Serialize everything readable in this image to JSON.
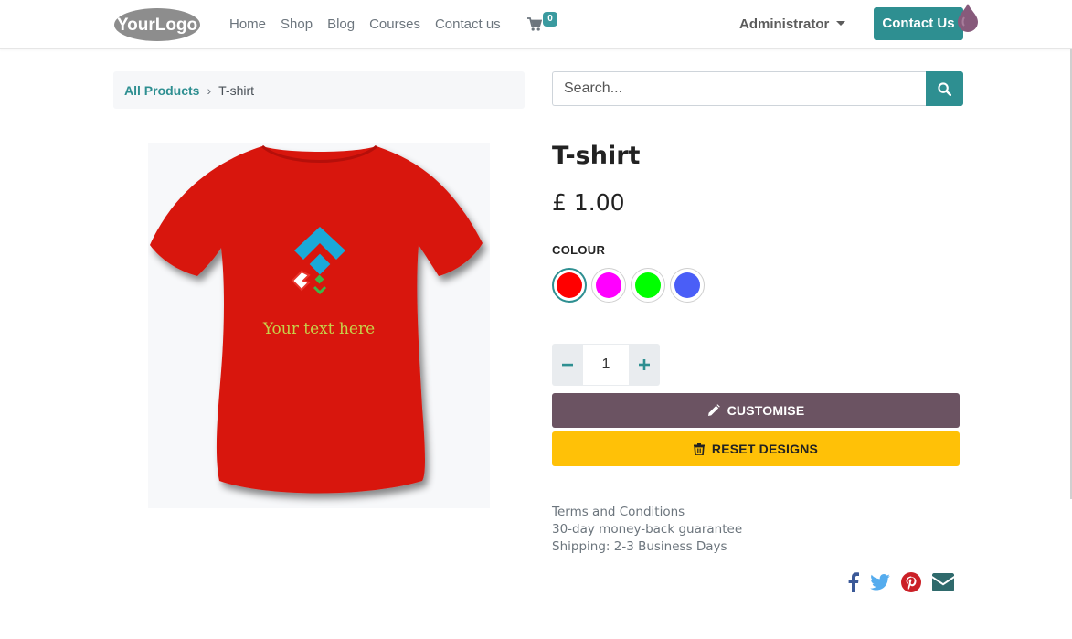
{
  "header": {
    "logo_text": "YourLogo",
    "nav": [
      "Home",
      "Shop",
      "Blog",
      "Courses",
      "Contact us"
    ],
    "cart_count": "0",
    "user_menu": "Administrator",
    "contact_button": "Contact Us"
  },
  "breadcrumb": {
    "parent": "All Products",
    "current": "T-shirt"
  },
  "search": {
    "placeholder": "Search..."
  },
  "product": {
    "image_caption": "Your text here",
    "name": "T-shirt",
    "price": "£ 1.00",
    "attribute_label": "COLOUR",
    "colours": [
      {
        "name": "red",
        "hex": "#ff0000",
        "selected": true
      },
      {
        "name": "magenta",
        "hex": "#ff00ff",
        "selected": false
      },
      {
        "name": "green",
        "hex": "#00ff00",
        "selected": false
      },
      {
        "name": "blue",
        "hex": "#4a5ef7",
        "selected": false
      }
    ],
    "quantity": "1",
    "customise_label": "CUSTOMISE",
    "reset_label": "RESET DESIGNS"
  },
  "terms": {
    "line1": "Terms and Conditions",
    "line2": "30-day money-back guarantee",
    "line3": "Shipping: 2-3 Business Days"
  },
  "social_icons": [
    "facebook-icon",
    "twitter-icon",
    "pinterest-icon",
    "email-icon"
  ],
  "colors": {
    "accent": "#2e8f91",
    "customise_bg": "#6b5362",
    "reset_bg": "#ffc107",
    "tshirt": "#d8150f"
  }
}
